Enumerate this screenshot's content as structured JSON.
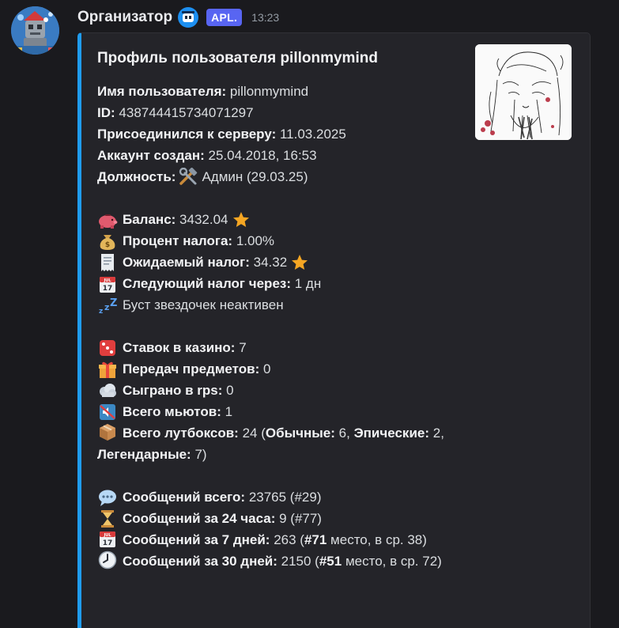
{
  "message": {
    "author": "Организатор",
    "app_tag": "APL.",
    "timestamp": "13:23",
    "avatar_icon": "robot-avatar-icon",
    "badge_icon": "bot-badge-icon"
  },
  "embed": {
    "accent_color": "#1f9cf0",
    "title": "Профиль пользователя pillonmymind",
    "thumbnail_icon": "sketch-avatar-thumbnail",
    "info": {
      "username_label": "Имя пользователя:",
      "username_value": "pillonmymind",
      "id_label": "ID:",
      "id_value": "438744415734071297",
      "joined_label": "Присоединился к серверу:",
      "joined_value": "11.03.2025",
      "created_label": "Аккаунт создан:",
      "created_value": "25.04.2018, 16:53",
      "role_label": "Должность:",
      "role_icon": "hammer-wrench-icon",
      "role_value": "Админ (29.03.25)"
    },
    "economy": {
      "balance_icon": "piggy-bank-icon",
      "balance_label": "Баланс:",
      "balance_value": "3432.04",
      "tax_rate_icon": "money-bag-icon",
      "tax_rate_label": "Процент налога:",
      "tax_rate_value": "1.00%",
      "expected_tax_icon": "receipt-icon",
      "expected_tax_label": "Ожидаемый налог:",
      "expected_tax_value": "34.32",
      "next_tax_icon": "calendar-icon",
      "next_tax_label": "Следующий налог через:",
      "next_tax_value": "1 дн",
      "boost_icon": "zzz-icon",
      "boost_text": "Буст звездочек неактивен",
      "star_icon": "star-icon"
    },
    "stats": {
      "casino_icon": "dice-icon",
      "casino_label": "Ставок в казино:",
      "casino_value": "7",
      "transfers_icon": "gift-icon",
      "transfers_label": "Передач предметов:",
      "transfers_value": "0",
      "rps_icon": "cloud-icon",
      "rps_label": "Сыграно в rps:",
      "rps_value": "0",
      "mutes_icon": "muted-speaker-icon",
      "mutes_label": "Всего мьютов:",
      "mutes_value": "1",
      "lootboxes_icon": "package-icon",
      "lootboxes_label": "Всего лутбоксов:",
      "lootboxes_value": "24",
      "common_label": "Обычные:",
      "common_value": "6,",
      "epic_label": "Эпические:",
      "epic_value": "2,",
      "legendary_label": "Легендарные:",
      "legendary_value": "7)"
    },
    "messages": {
      "total_icon": "speech-bubble-icon",
      "total_label": "Сообщений всего:",
      "total_value": "23765 (#29)",
      "day_icon": "hourglass-icon",
      "day_label": "Сообщений за 24 часа:",
      "day_value": "9 (#77)",
      "week_icon": "calendar-icon",
      "week_label": "Сообщений за 7 дней:",
      "week_value": "263 (",
      "week_rank": "#71",
      "week_tail": "место, в ср. 38)",
      "month_icon": "clock-icon",
      "month_label": "Сообщений за 30 дней:",
      "month_value": "2150 (",
      "month_rank": "#51",
      "month_tail": "место, в ср. 72)"
    }
  }
}
